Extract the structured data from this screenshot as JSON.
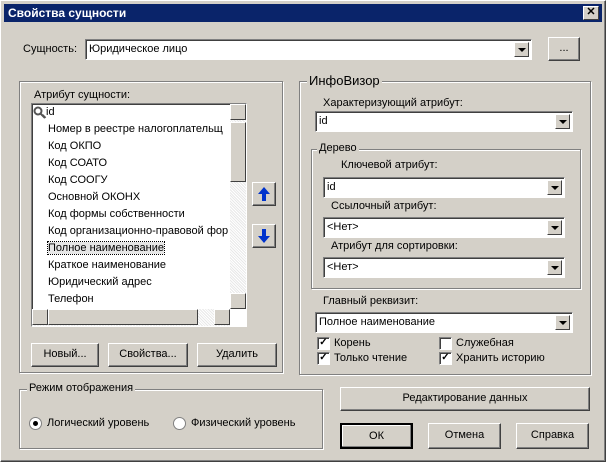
{
  "window": {
    "title": "Свойства сущности"
  },
  "entity": {
    "label": "Сущность:",
    "value": "Юридическое лицо",
    "browse_label": "..."
  },
  "attributes": {
    "group_title": "Атрибут сущности:",
    "items": [
      "id",
      "Номер в реестре налогоплательщ",
      "Код ОКПО",
      "Код СОАТО",
      "Код СООГУ",
      "Основной ОКОНХ",
      "Код формы собственности",
      "Код организационно-правовой фор",
      "Полное наименование",
      "Краткое наименование",
      "Юридический адрес",
      "Телефон"
    ],
    "selected_index": 8,
    "key_icon": "key-icon",
    "buttons": {
      "new": "Новый...",
      "props": "Свойства...",
      "delete": "Удалить"
    }
  },
  "infovisor": {
    "title": "ИнфоВизор",
    "characterizing_label": "Характеризующий атрибут:",
    "characterizing_value": "id",
    "tree": {
      "title": "Дерево",
      "key_label": "Ключевой атрибут:",
      "key_value": "id",
      "ref_label": "Ссылочный атрибут:",
      "ref_value": "<Нет>",
      "sort_label": "Атрибут для сортировки:",
      "sort_value": "<Нет>"
    },
    "main_label": "Главный реквизит:",
    "main_value": "Полное наименование",
    "checks": [
      {
        "label": "Корень",
        "checked": true
      },
      {
        "label": "Служебная",
        "checked": false
      },
      {
        "label": "Только чтение",
        "checked": true
      },
      {
        "label": "Хранить историю",
        "checked": true
      }
    ]
  },
  "mode": {
    "title": "Режим отображения",
    "logical": "Логический уровень",
    "physical": "Физический уровень",
    "selected": "logical"
  },
  "footer": {
    "edit_data": "Редактирование данных",
    "ok": "ОК",
    "cancel": "Отмена",
    "help": "Справка"
  }
}
